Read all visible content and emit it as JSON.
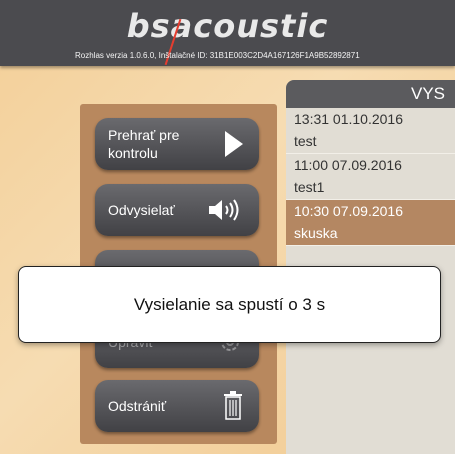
{
  "header": {
    "logo_text": "bsacoustic",
    "version_info": "Rozhlas verzia 1.0.6.0, Inštalačné ID: 31B1E003C2D4A167126F1A9B52892871"
  },
  "sidebar": {
    "buttons": [
      {
        "label": "Prehrať pre kontrolu",
        "icon": "play-icon"
      },
      {
        "label": "Odvysielať",
        "icon": "speaker-icon"
      },
      {
        "label": "",
        "icon": "hidden"
      },
      {
        "label": "Upraviť",
        "icon": "gear-icon"
      },
      {
        "label": "Odstrániť",
        "icon": "trash-icon"
      }
    ]
  },
  "list": {
    "header": "VYS",
    "items": [
      {
        "datetime": "13:31 01.10.2016",
        "name": "test",
        "selected": false
      },
      {
        "datetime": "11:00 07.09.2016",
        "name": "test1",
        "selected": false
      },
      {
        "datetime": "10:30 07.09.2016",
        "name": "skuska",
        "selected": true
      }
    ]
  },
  "dialog": {
    "message": "Vysielanie sa spustí o 3 s"
  },
  "colors": {
    "header_bg": "#4b4b4f",
    "sidebar_bg": "#b8885e",
    "selected_bg": "#b48762",
    "accent_red": "#e53d2f"
  }
}
